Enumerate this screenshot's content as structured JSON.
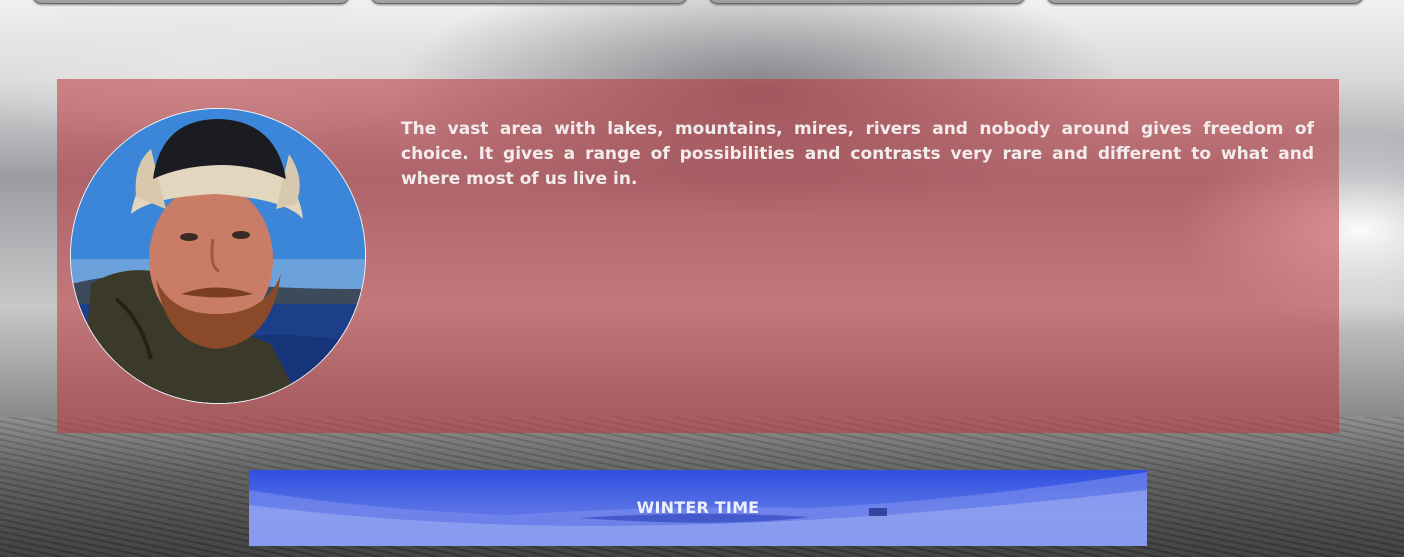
{
  "nav": {
    "buttons": [
      "",
      "",
      "",
      ""
    ]
  },
  "intro": {
    "paragraph": "The vast area with lakes, mountains, mires, rivers and nobody around gives freedom of choice. It gives a range of possibilities and contrasts very rare and different to what and where most of us live in.",
    "panel_color": "#be373c",
    "avatar_image": "portrait photo of a bearded man in a sheepskin hat by a lake"
  },
  "winter": {
    "label": "WINTER TIME",
    "color": "#3a56e0"
  }
}
